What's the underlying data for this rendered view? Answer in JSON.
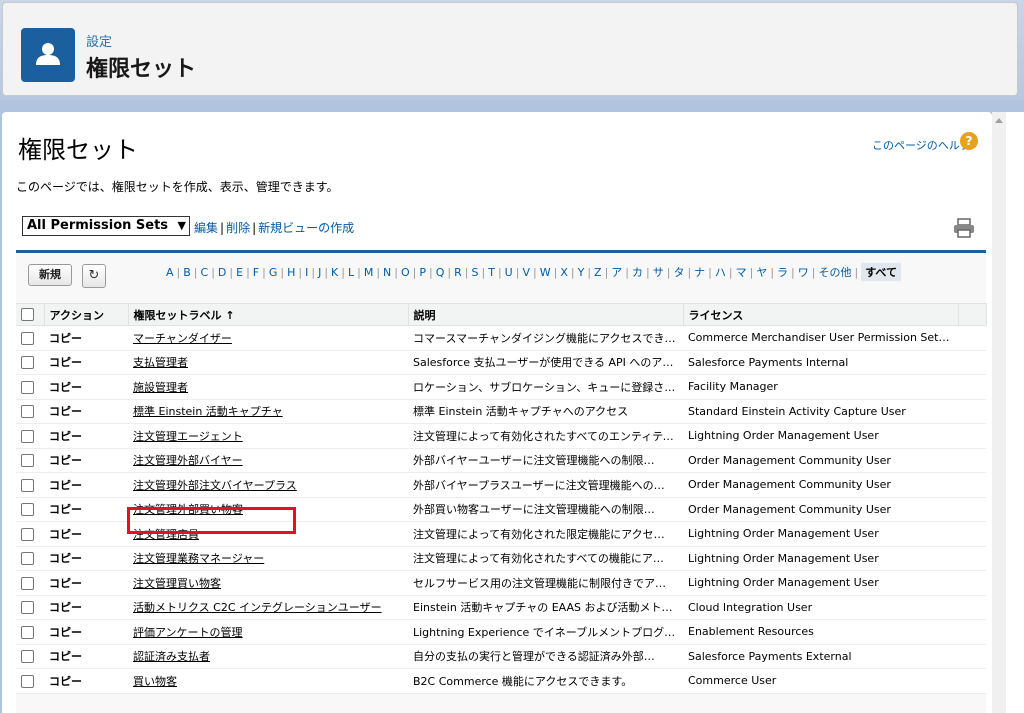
{
  "header": {
    "breadcrumb": "設定",
    "title": "権限セット",
    "icon": "user-icon"
  },
  "page": {
    "title": "権限セット",
    "help_link": "このページのヘルプ",
    "help_icon": "?",
    "description": "このページでは、権限セットを作成、表示、管理できます。"
  },
  "view": {
    "selected": "All Permission Sets",
    "edit": "編集",
    "delete": "削除",
    "create_view": "新規ビューの作成"
  },
  "toolbar": {
    "new_label": "新規",
    "refresh_icon": "↻"
  },
  "alpha_filter": [
    "A",
    "B",
    "C",
    "D",
    "E",
    "F",
    "G",
    "H",
    "I",
    "J",
    "K",
    "L",
    "M",
    "N",
    "O",
    "P",
    "Q",
    "R",
    "S",
    "T",
    "U",
    "V",
    "W",
    "X",
    "Y",
    "Z",
    "ア",
    "カ",
    "サ",
    "タ",
    "ナ",
    "ハ",
    "マ",
    "ヤ",
    "ラ",
    "ワ",
    "その他",
    "すべて"
  ],
  "alpha_selected": "すべて",
  "table": {
    "headers": {
      "action": "アクション",
      "label": "権限セットラベル ↑",
      "description": "説明",
      "license": "ライセンス"
    },
    "rows": [
      {
        "action": "コピー",
        "label": "マーチャンダイザー",
        "description": "コマースマーチャンダイジング機能にアクセスできます。",
        "license": "Commerce Merchandiser User Permission Set…"
      },
      {
        "action": "コピー",
        "label": "支払管理者",
        "description": "Salesforce 支払ユーザーが使用できる API へのア…",
        "license": "Salesforce Payments Internal"
      },
      {
        "action": "コピー",
        "label": "施設管理者",
        "description": "ロケーション、サブロケーション、キューに登録されたー…",
        "license": "Facility Manager"
      },
      {
        "action": "コピー",
        "label": "標準 Einstein 活動キャプチャ",
        "description": "標準 Einstein 活動キャプチャへのアクセス",
        "license": "Standard Einstein Activity Capture User"
      },
      {
        "action": "コピー",
        "label": "注文管理エージェント",
        "description": "注文管理によって有効化されたすべてのエンティティ…",
        "license": "Lightning Order Management User"
      },
      {
        "action": "コピー",
        "label": "注文管理外部バイヤー",
        "description": "外部バイヤーユーザーに注文管理機能への制限…",
        "license": "Order Management Community User"
      },
      {
        "action": "コピー",
        "label": "注文管理外部注文バイヤープラス",
        "description": "外部バイヤープラスユーザーに注文管理機能への…",
        "license": "Order Management Community User"
      },
      {
        "action": "コピー",
        "label": "注文管理外部買い物客",
        "description": "外部買い物客ユーザーに注文管理機能への制限…",
        "license": "Order Management Community User"
      },
      {
        "action": "コピー",
        "label": "注文管理店員",
        "description": "注文管理によって有効化された限定機能にアクセ…",
        "license": "Lightning Order Management User"
      },
      {
        "action": "コピー",
        "label": "注文管理業務マネージャー",
        "description": "注文管理によって有効化されたすべての機能にア…",
        "license": "Lightning Order Management User"
      },
      {
        "action": "コピー",
        "label": "注文管理買い物客",
        "description": "セルフサービス用の注文管理機能に制限付きでア…",
        "license": "Lightning Order Management User"
      },
      {
        "action": "コピー",
        "label": "活動メトリクス C2C インテグレーションユーザー",
        "description": "Einstein 活動キャプチャの EAAS および活動メトリ…",
        "license": "Cloud Integration User"
      },
      {
        "action": "コピー",
        "label": "評価アンケートの管理",
        "description": "Lightning Experience でイネーブルメントプログラム…",
        "license": "Enablement Resources"
      },
      {
        "action": "コピー",
        "label": "認証済み支払者",
        "description": "自分の支払の実行と管理ができる認証済み外部…",
        "license": "Salesforce Payments External"
      },
      {
        "action": "コピー",
        "label": "買い物客",
        "description": "B2C Commerce 機能にアクセスできます。",
        "license": "Commerce User"
      }
    ]
  },
  "colors": {
    "brand": "#1b5f9e",
    "link": "#015ba7",
    "highlight": "#e8101a",
    "help": "#e8a21d"
  }
}
